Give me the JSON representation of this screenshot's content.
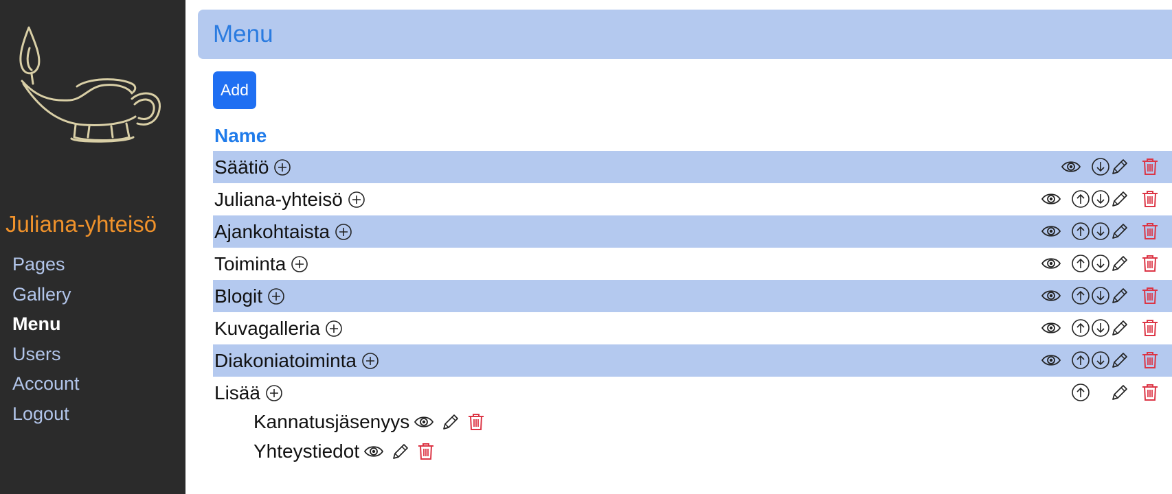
{
  "sidebar": {
    "logo": "oil-lamp-logo",
    "site_title": "Juliana-yhteisö",
    "nav": [
      {
        "label": "Pages",
        "active": false
      },
      {
        "label": "Gallery",
        "active": false
      },
      {
        "label": "Menu",
        "active": true
      },
      {
        "label": "Users",
        "active": false
      },
      {
        "label": "Account",
        "active": false
      },
      {
        "label": "Logout",
        "active": false
      }
    ]
  },
  "header": {
    "title": "Menu"
  },
  "toolbar": {
    "add_label": "Add"
  },
  "table": {
    "column_name": "Name",
    "rows": [
      {
        "name": "Säätiö",
        "up": false,
        "down": true,
        "view": true
      },
      {
        "name": "Juliana-yhteisö",
        "up": true,
        "down": true,
        "view": true
      },
      {
        "name": "Ajankohtaista",
        "up": true,
        "down": true,
        "view": true
      },
      {
        "name": "Toiminta",
        "up": true,
        "down": true,
        "view": true
      },
      {
        "name": "Blogit",
        "up": true,
        "down": true,
        "view": true
      },
      {
        "name": "Kuvagalleria",
        "up": true,
        "down": true,
        "view": true
      },
      {
        "name": "Diakoniatoiminta",
        "up": true,
        "down": true,
        "view": true
      },
      {
        "name": "Lisää",
        "up": true,
        "down": false,
        "view": false
      }
    ],
    "subitems": [
      {
        "parent": "Lisää",
        "name": "Kannatusjäsenyys"
      },
      {
        "parent": "Lisää",
        "name": "Yhteystiedot"
      }
    ]
  },
  "colors": {
    "sidebar_bg": "#2b2b2b",
    "accent_orange": "#f0922b",
    "nav_link": "#b2c5ea",
    "row_highlight": "#b4c9ef",
    "primary_blue": "#1f6ff2",
    "delete_red": "#dc3545"
  }
}
